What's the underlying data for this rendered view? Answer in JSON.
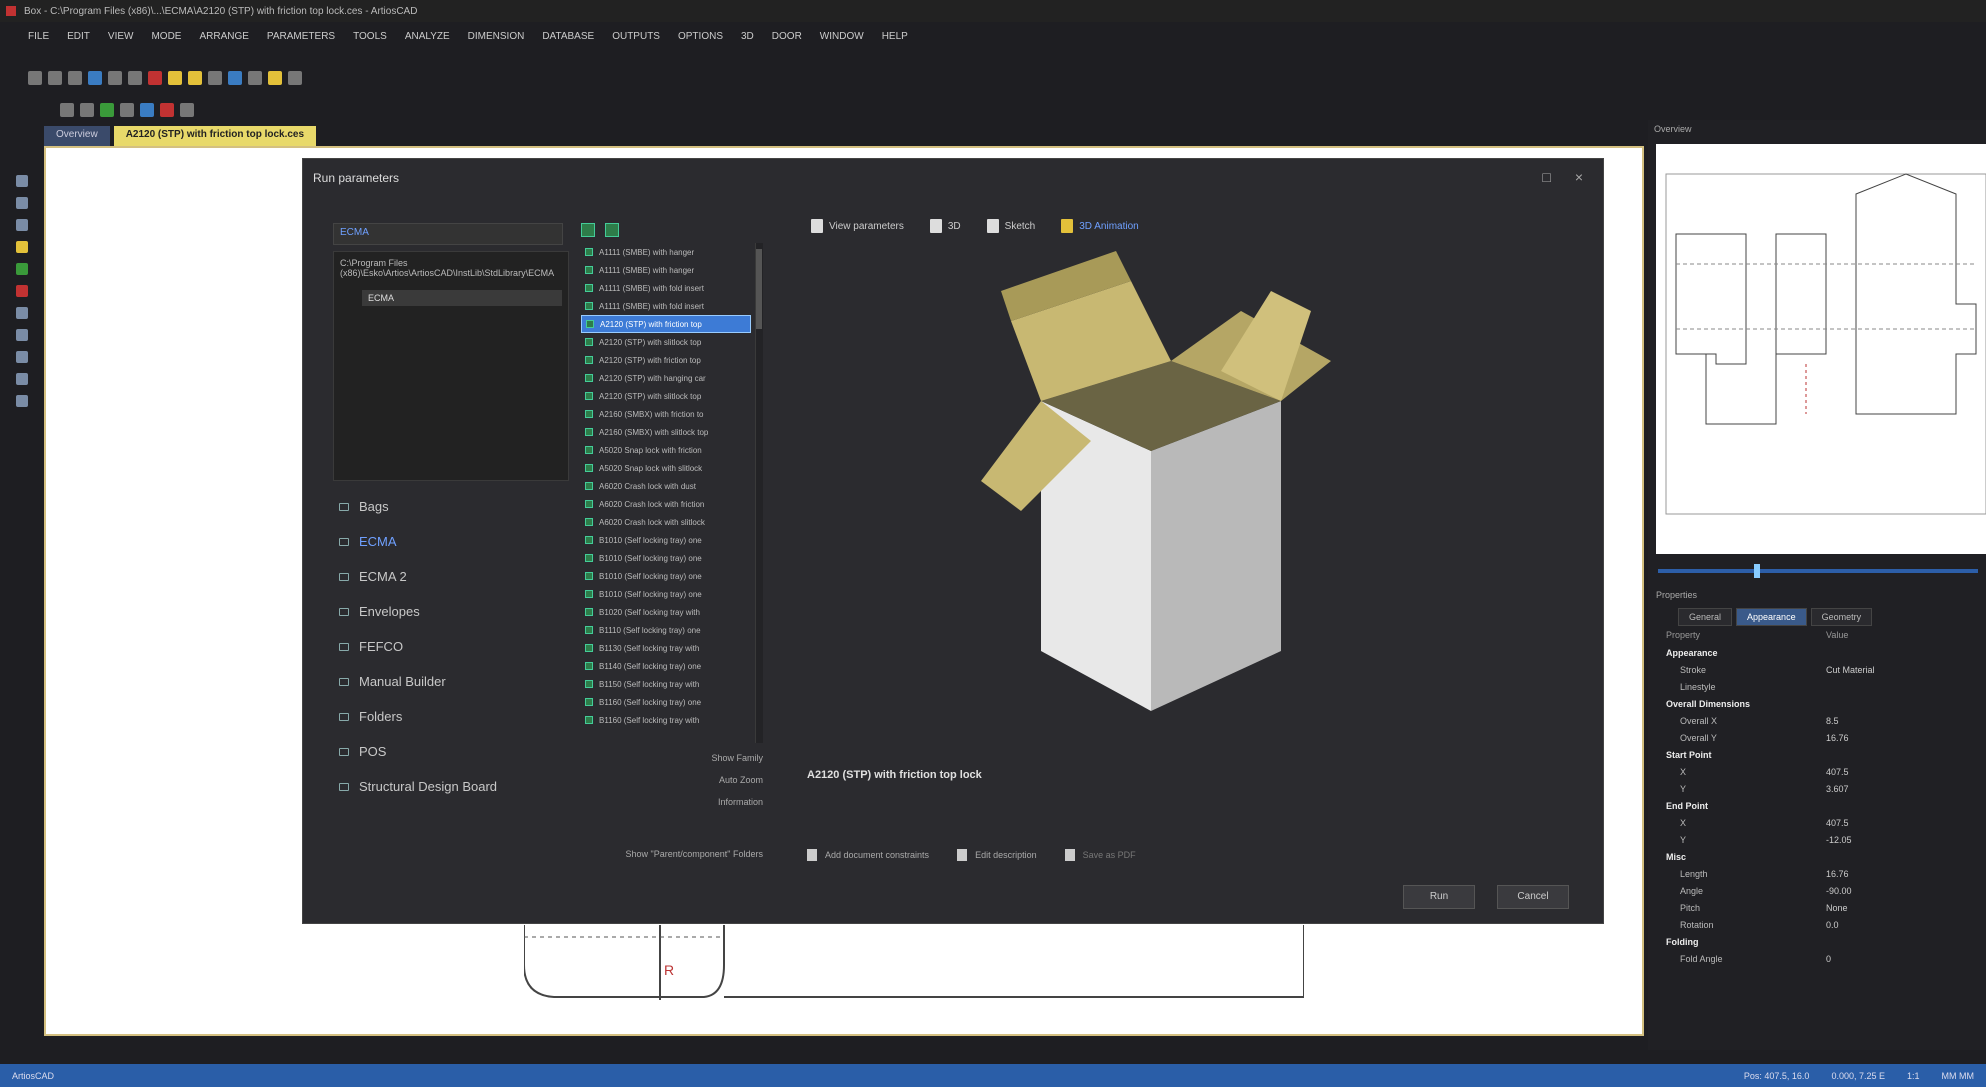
{
  "window": {
    "title": "Box - C:\\Program Files (x86)\\...\\ECMA\\A2120 (STP) with friction top lock.ces - ArtiosCAD"
  },
  "menu": [
    "FILE",
    "EDIT",
    "VIEW",
    "MODE",
    "ARRANGE",
    "PARAMETERS",
    "TOOLS",
    "ANALYZE",
    "DIMENSION",
    "DATABASE",
    "OUTPUTS",
    "OPTIONS",
    "3D",
    "DOOR",
    "WINDOW",
    "HELP"
  ],
  "tabs": [
    "Overview",
    "A2120 (STP) with friction top lock.ces"
  ],
  "dialog": {
    "title": "Run parameters",
    "library_label": "ECMA",
    "library_path": "C:\\Program Files (x86)\\Esko\\Artios\\ArtiosCAD\\InstLib\\StdLibrary\\ECMA",
    "tree_node": "ECMA",
    "categories": [
      "Bags",
      "ECMA",
      "ECMA 2",
      "Envelopes",
      "FEFCO",
      "Manual Builder",
      "Folders",
      "POS",
      "Structural Design Board"
    ],
    "standards": [
      "A1111 (SMBE) with hanger",
      "A1111 (SMBE) with hanger",
      "A1111 (SMBE) with fold insert",
      "A1111 (SMBE) with fold insert",
      "A2120 (STP) with friction top",
      "A2120 (STP) with slitlock top",
      "A2120 (STP) with friction top",
      "A2120 (STP) with hanging car",
      "A2120 (STP) with slitlock top",
      "A2160 (SMBX) with friction to",
      "A2160 (SMBX) with slitlock top",
      "A5020 Snap lock with friction",
      "A5020 Snap lock with slitlock",
      "A6020 Crash lock with dust",
      "A6020 Crash lock with friction",
      "A6020 Crash lock with slitlock",
      "B1010 (Self locking tray) one",
      "B1010 (Self locking tray) one",
      "B1010 (Self locking tray) one",
      "B1010 (Self locking tray) one",
      "B1020 (Self locking tray with",
      "B1110 (Self locking tray) one",
      "B1130 (Self locking tray with",
      "B1140 (Self locking tray) one",
      "B1150 (Self locking tray with",
      "B1160 (Self locking tray) one",
      "B1160 (Self locking tray with"
    ],
    "selected_standard_index": 4,
    "list_options": [
      "Show Family",
      "Auto Zoom",
      "Information"
    ],
    "show_toggle": "Show \"Parent/component\" Folders",
    "view_buttons": [
      "View parameters",
      "3D",
      "Sketch",
      "3D Animation"
    ],
    "standard_name": "A2120 (STP) with friction top lock",
    "options": [
      "Add document constraints",
      "Edit description",
      "Save as PDF"
    ],
    "run_label": "Run",
    "cancel_label": "Cancel"
  },
  "right_panel": {
    "overview_title": "Overview",
    "properties_title": "Properties",
    "tabs": [
      "General",
      "Appearance",
      "Geometry"
    ],
    "col_headers": [
      "Property",
      "Value"
    ],
    "rows": [
      {
        "k": "Appearance",
        "v": "",
        "h": true
      },
      {
        "k": "Stroke",
        "v": "Cut Material"
      },
      {
        "k": "Linestyle",
        "v": ""
      },
      {
        "k": "Overall Dimensions",
        "v": "",
        "h": true
      },
      {
        "k": "Overall X",
        "v": "8.5"
      },
      {
        "k": "Overall Y",
        "v": "16.76"
      },
      {
        "k": "Start Point",
        "v": "",
        "h": true
      },
      {
        "k": "X",
        "v": "407.5"
      },
      {
        "k": "Y",
        "v": "3.607"
      },
      {
        "k": "End Point",
        "v": "",
        "h": true
      },
      {
        "k": "X",
        "v": "407.5"
      },
      {
        "k": "Y",
        "v": "-12.05"
      },
      {
        "k": "Misc",
        "v": "",
        "h": true
      },
      {
        "k": "Length",
        "v": "16.76"
      },
      {
        "k": "Angle",
        "v": "-90.00"
      },
      {
        "k": "Pitch",
        "v": "None"
      },
      {
        "k": "Rotation",
        "v": "0.0"
      },
      {
        "k": "Folding",
        "v": "",
        "h": true
      },
      {
        "k": "Fold Angle",
        "v": "0"
      }
    ]
  },
  "status": {
    "left": "ArtiosCAD",
    "right": [
      "Pos: 407.5, 16.0",
      "0.000, 7.25 E",
      "1:1",
      "MM MM"
    ]
  },
  "colors": {
    "accent": "#2a5ea8",
    "tab_active": "#e8d96a",
    "box_flap": "#c8b872",
    "box_body": "#d8d8d8"
  }
}
